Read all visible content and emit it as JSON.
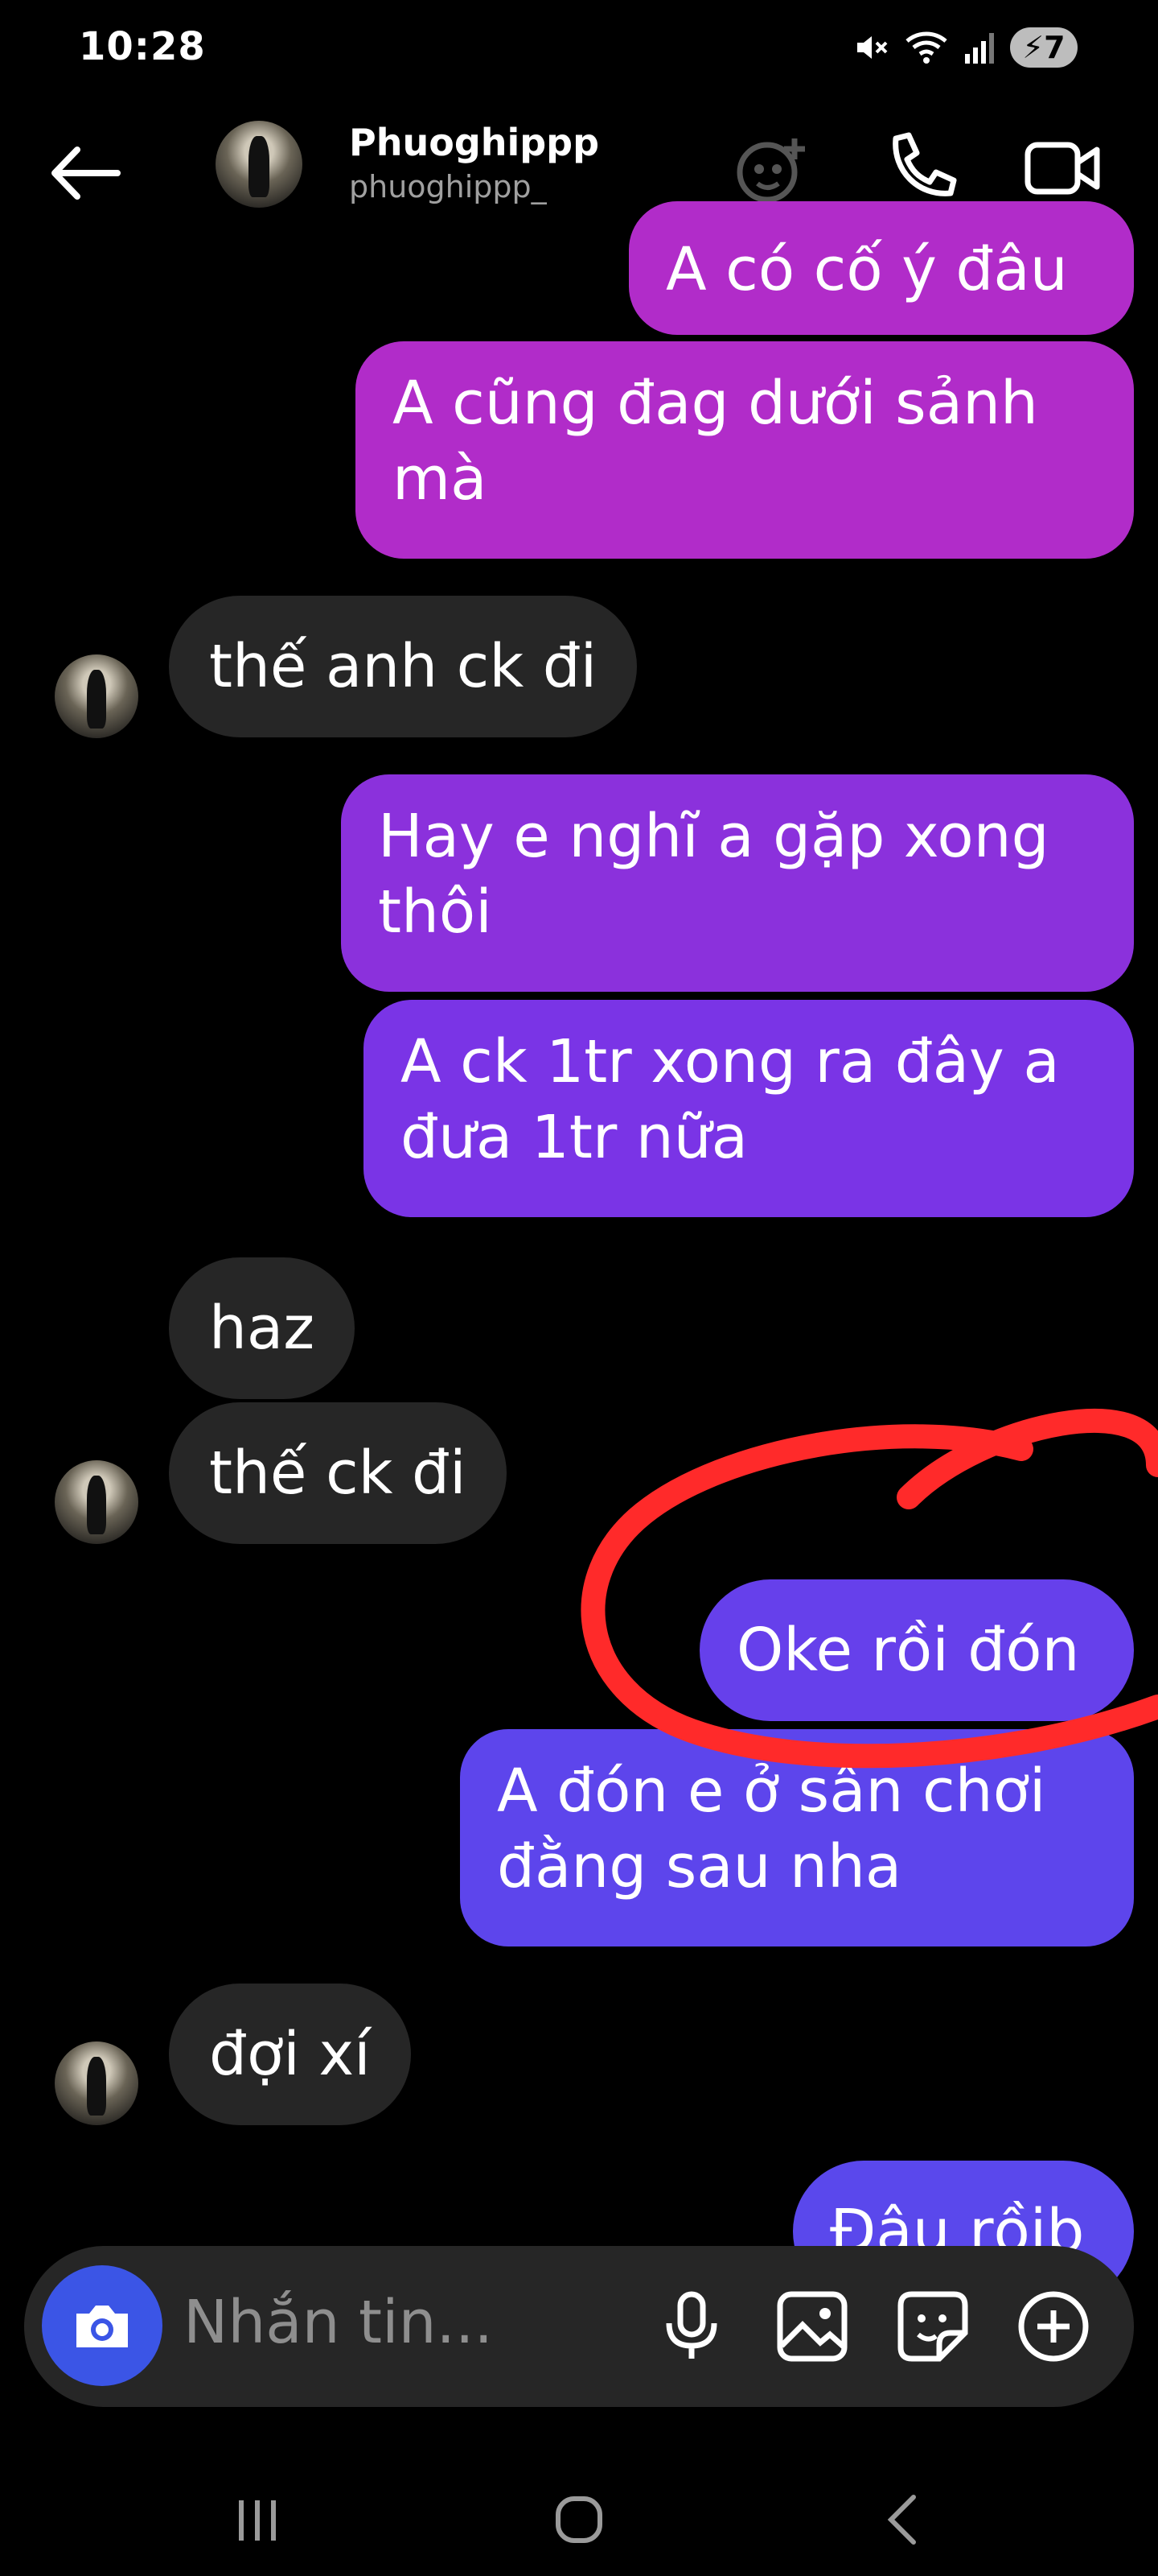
{
  "status": {
    "time": "10:28",
    "battery": "7"
  },
  "header": {
    "name": "Phuoghippp",
    "handle": "phuoghippp_"
  },
  "messages": [
    {
      "dir": "out",
      "text": "A có cố ý đâu"
    },
    {
      "dir": "out",
      "text": "A cũng đag dưới sảnh mà"
    },
    {
      "dir": "in",
      "text": "thế anh ck đi"
    },
    {
      "dir": "out",
      "text": "Hay e nghĩ a gặp xong thôi"
    },
    {
      "dir": "out",
      "text": "A ck 1tr xong ra đây a đưa 1tr nữa"
    },
    {
      "dir": "in",
      "text": "haz"
    },
    {
      "dir": "in",
      "text": "thế ck đi"
    },
    {
      "dir": "out",
      "text": "Oke rồi đón"
    },
    {
      "dir": "out",
      "text": "A đón e ở sân chơi đằng sau nha"
    },
    {
      "dir": "in",
      "text": "đợi xí"
    },
    {
      "dir": "out",
      "text": "Đâu rồib"
    }
  ],
  "composer": {
    "placeholder": "Nhắn tin..."
  },
  "colors": {
    "incoming_bubble": "#262626",
    "outgoing_magenta": "#b12cc9",
    "outgoing_purple": "#7a34e6",
    "outgoing_indigo": "#5d45ec",
    "camera_button": "#3b55e6",
    "annotation_red": "#ff2a2a"
  },
  "icons": [
    "back-arrow-icon",
    "add-friend-icon",
    "phone-icon",
    "video-icon",
    "camera-icon",
    "mic-icon",
    "gallery-icon",
    "sticker-icon",
    "plus-circle-icon"
  ]
}
